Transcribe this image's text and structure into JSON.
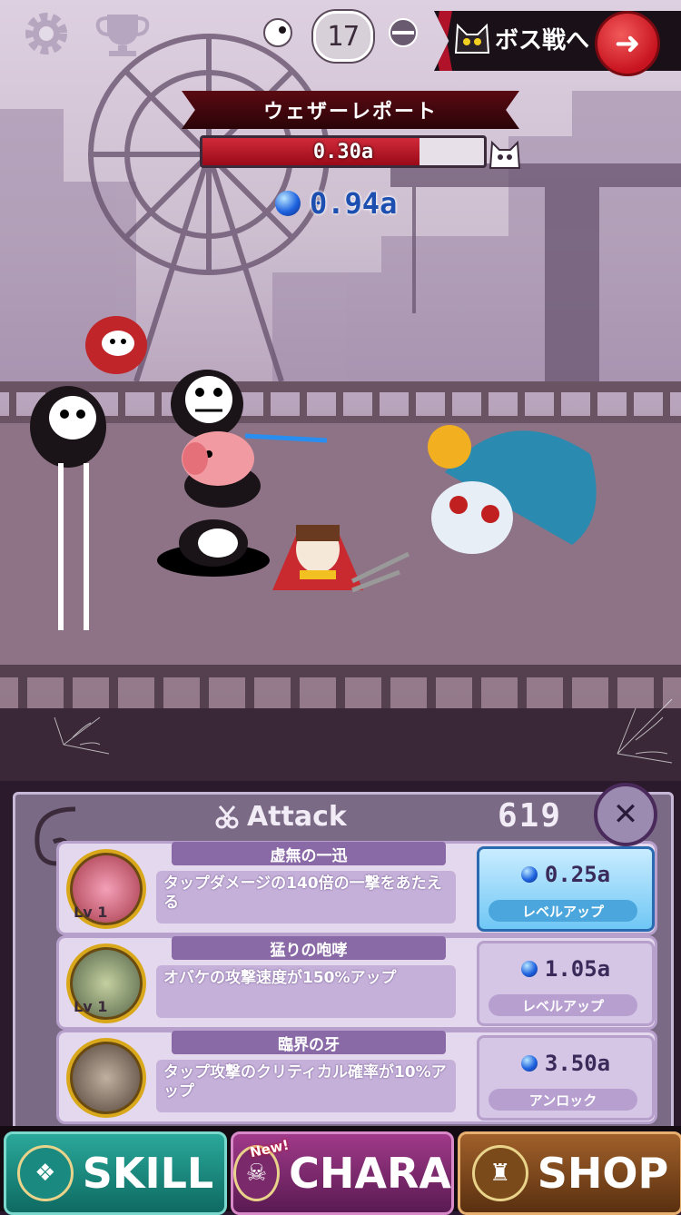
{
  "header": {
    "counter": "17",
    "boss_label": "ボス戦へ"
  },
  "enemy": {
    "name": "ウェザーレポート",
    "hp_text": "0.30a",
    "hp_fraction": 0.77
  },
  "currency": {
    "value": "0.94a"
  },
  "panel": {
    "title": "Attack",
    "count": "619",
    "skills": [
      {
        "title": "虚無の一迅",
        "description": "タップダメージの140倍の一撃をあたえる",
        "level": "Lv 1",
        "cost": "0.25a",
        "button": "レベルアップ",
        "active": true
      },
      {
        "title": "猛りの咆哮",
        "description": "オバケの攻撃速度が150%アップ",
        "level": "Lv 1",
        "cost": "1.05a",
        "button": "レベルアップ",
        "active": false
      },
      {
        "title": "臨界の牙",
        "description": "タップ攻撃のクリティカル確率が10%アップ",
        "level": "",
        "cost": "3.50a",
        "button": "アンロック",
        "active": false
      }
    ]
  },
  "tabs": {
    "skill": "SKILL",
    "chara": "CHARA",
    "shop": "SHOP",
    "new_badge": "New!"
  },
  "colors": {
    "accent_red": "#c81420",
    "orb_blue": "#1f63e0",
    "panel_bg": "#7a6a86"
  },
  "icons": [
    "gear-icon",
    "trophy-icon",
    "ghost-orb-icon",
    "cat-boss-icon",
    "arrow-right-icon",
    "close-icon",
    "scissors-icon",
    "shield-icon",
    "skull-icon",
    "castle-icon"
  ]
}
